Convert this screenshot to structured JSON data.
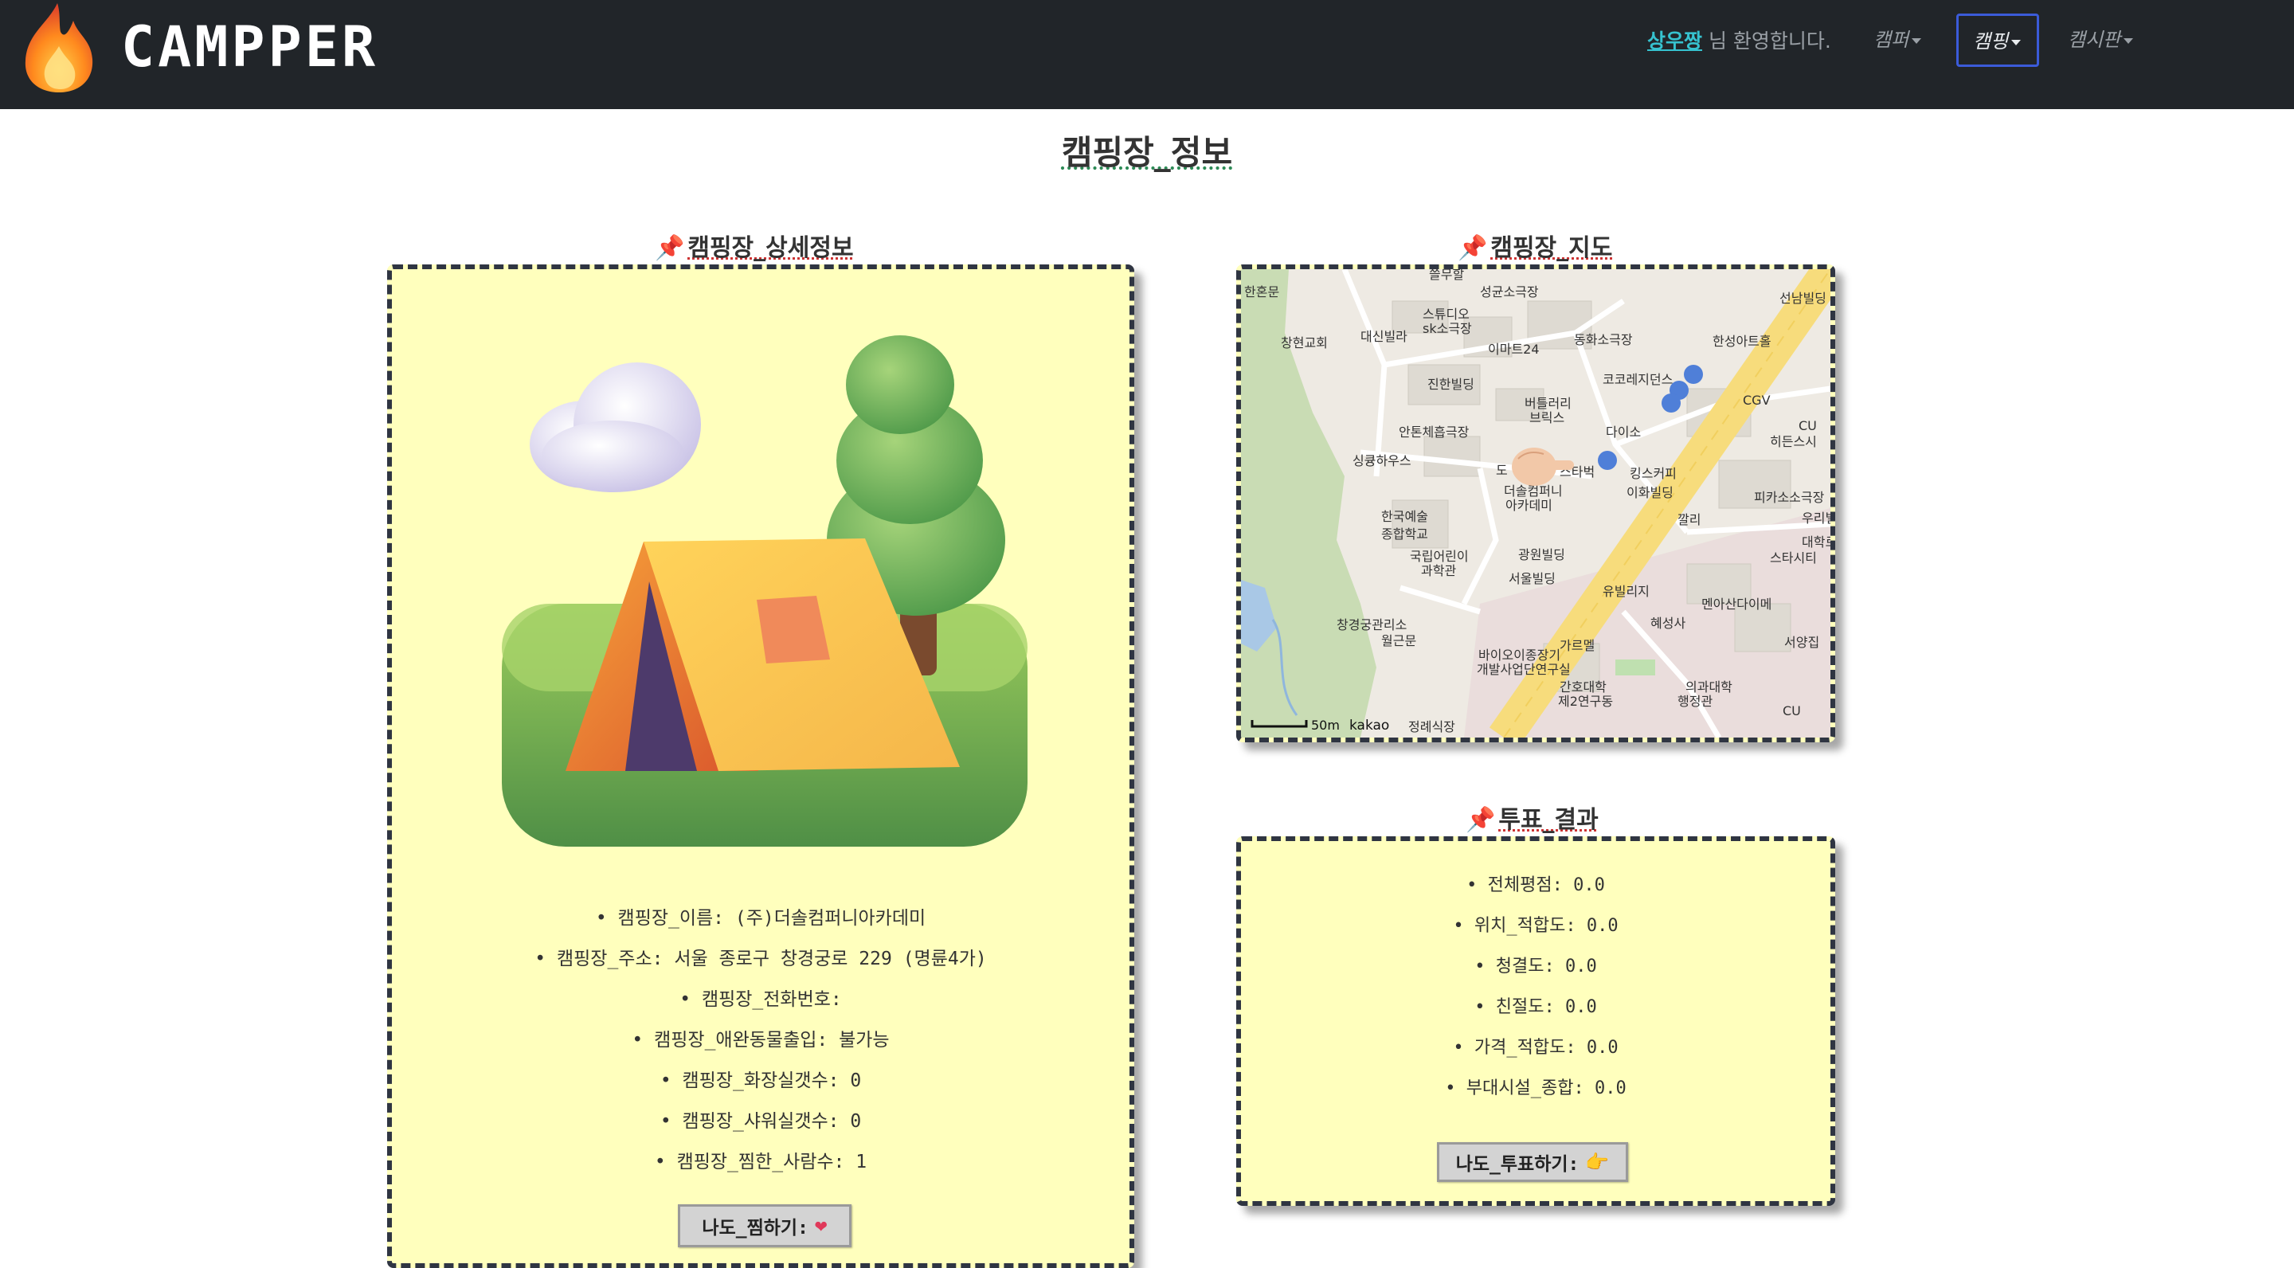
{
  "app": {
    "name": "CAMPPER"
  },
  "navbar": {
    "user_name": "상우짱",
    "welcome_suffix": "님 환영합니다.",
    "menus": [
      {
        "label": "캠퍼",
        "active": false
      },
      {
        "label": "캠핑",
        "active": true
      },
      {
        "label": "캠시판",
        "active": false
      }
    ]
  },
  "page": {
    "title": "캠핑장_정보"
  },
  "detail": {
    "section_title": "캠핑장_상세정보",
    "image_icon": "tent-tree-cloud-illustration",
    "info": [
      "캠핑장_이름: (주)더솔컴퍼니아카데미",
      "캠핑장_주소: 서울 종로구 창경궁로 229 (명륜4가)",
      "캠핑장_전화번호:",
      "캠핑장_애완동물출입: 불가능",
      "캠핑장_화장실갯수: 0",
      "캠핑장_샤워실갯수: 0",
      "캠핑장_찜한_사람수: 1"
    ],
    "like_button_label": "나도_찜하기:",
    "like_icon": "heart-icon"
  },
  "map": {
    "section_title": "캠핑장_지도",
    "labels": [
      "쓸무할",
      "성균소극장",
      "선남빌딩",
      "한혼문",
      "창현교회",
      "대신빌라",
      "스튜디오",
      "sk소극장",
      "이마트24",
      "동화소극장",
      "한성아트홀",
      "코코레지던스",
      "CGV",
      "진한빌딩",
      "버틀러리",
      "브릭스",
      "CU",
      "안톤체흡극장",
      "다이소",
      "히든스시",
      "싱큥하우스",
      "도",
      "스타벅",
      "킹스커피",
      "더솔컴퍼니",
      "아카데미",
      "이화빌딩",
      "피카소소극장",
      "한국예술",
      "종합학교",
      "우리빌",
      "깔리",
      "대학로",
      "스타시티",
      "국립어린이",
      "과학관",
      "광원빌딩",
      "서울빌딩",
      "유빌리지",
      "멘아산다이메",
      "창경궁관리소",
      "혜성사",
      "월근문",
      "서양집",
      "가르멜",
      "바이오이종장기",
      "개발사업단연구실",
      "간호대학",
      "제2연구동",
      "의과대학",
      "행정관",
      "CU",
      "정례식장"
    ],
    "scale": "50m",
    "provider": "kakao",
    "marker_icon": "pointing-hand-icon"
  },
  "vote": {
    "section_title": "투표_결과",
    "items": [
      "전체평점: 0.0",
      "위치_적합도: 0.0",
      "청결도: 0.0",
      "친절도: 0.0",
      "가격_적합도: 0.0",
      "부대시설_종합: 0.0"
    ],
    "vote_button_label": "나도_투표하기:",
    "vote_icon": "pointing-hand-icon"
  },
  "colors": {
    "navbar_bg": "#212529",
    "card_bg": "#ffffbd",
    "user_link": "#36c2cf",
    "active_menu_border": "#3b5bd9"
  }
}
